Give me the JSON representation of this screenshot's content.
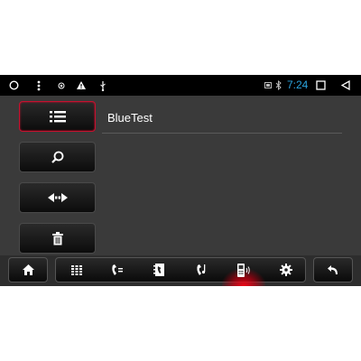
{
  "status_bar": {
    "time": "7:24",
    "left_icons": [
      "circle-icon",
      "menu-dots-icon",
      "record-icon",
      "warning-icon",
      "usb-icon"
    ],
    "right_icons": [
      "battery-icon",
      "bluetooth-icon",
      "square-icon",
      "back-triangle-icon"
    ]
  },
  "device": {
    "name": "BlueTest"
  },
  "sidebar": {
    "items": [
      {
        "icon": "list-icon",
        "active": true
      },
      {
        "icon": "search-icon",
        "active": false
      },
      {
        "icon": "connect-arrows-icon",
        "active": false
      },
      {
        "icon": "trash-icon",
        "active": false
      }
    ]
  },
  "bottom_nav": {
    "items": [
      {
        "icon": "dialpad-icon",
        "active": false
      },
      {
        "icon": "call-log-icon",
        "active": false
      },
      {
        "icon": "contacts-icon",
        "active": false
      },
      {
        "icon": "music-note-icon",
        "active": false
      },
      {
        "icon": "phone-bluetooth-icon",
        "active": true
      },
      {
        "icon": "settings-gear-icon",
        "active": false
      }
    ]
  },
  "colors": {
    "accent": "#c8102e",
    "clock": "#2ba5e0",
    "background": "#3a3a3a"
  }
}
